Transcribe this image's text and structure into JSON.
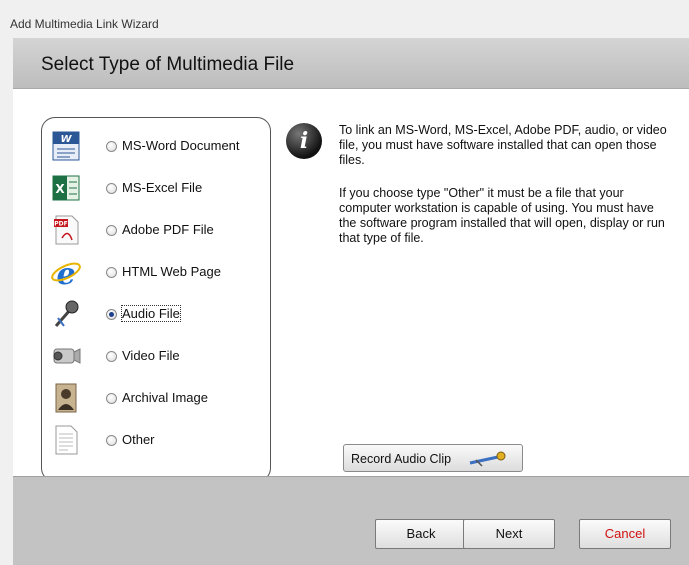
{
  "window": {
    "title": "Add Multimedia Link Wizard"
  },
  "header": {
    "title": "Select Type of Multimedia File"
  },
  "options": [
    {
      "label": "MS-Word Document",
      "icon": "word-document-icon",
      "selected": false
    },
    {
      "label": "MS-Excel File",
      "icon": "excel-file-icon",
      "selected": false
    },
    {
      "label": "Adobe PDF File",
      "icon": "pdf-file-icon",
      "selected": false
    },
    {
      "label": "HTML Web Page",
      "icon": "web-page-icon",
      "selected": false
    },
    {
      "label": "Audio File",
      "icon": "microphone-icon",
      "selected": true
    },
    {
      "label": "Video File",
      "icon": "video-camera-icon",
      "selected": false
    },
    {
      "label": "Archival Image",
      "icon": "archival-photo-icon",
      "selected": false
    },
    {
      "label": "Other",
      "icon": "document-icon",
      "selected": false
    }
  ],
  "info": {
    "icon": "info-icon",
    "paragraph1": "To link an MS-Word, MS-Excel, Adobe PDF, audio, or video file, you must have software installed that can open those files.",
    "paragraph2": "If you choose type \"Other\" it must be a file that your computer workstation is capable of using.  You must have the software program installed that will open, display or run that type of file."
  },
  "record_button": {
    "label": "Record Audio Clip",
    "icon": "microphone-icon"
  },
  "footer": {
    "back": "Back",
    "next": "Next",
    "cancel": "Cancel"
  },
  "colors": {
    "cancel_text": "#d01010",
    "header_bg": "#c8c8c8",
    "footer_bg": "#c3c3c3"
  }
}
